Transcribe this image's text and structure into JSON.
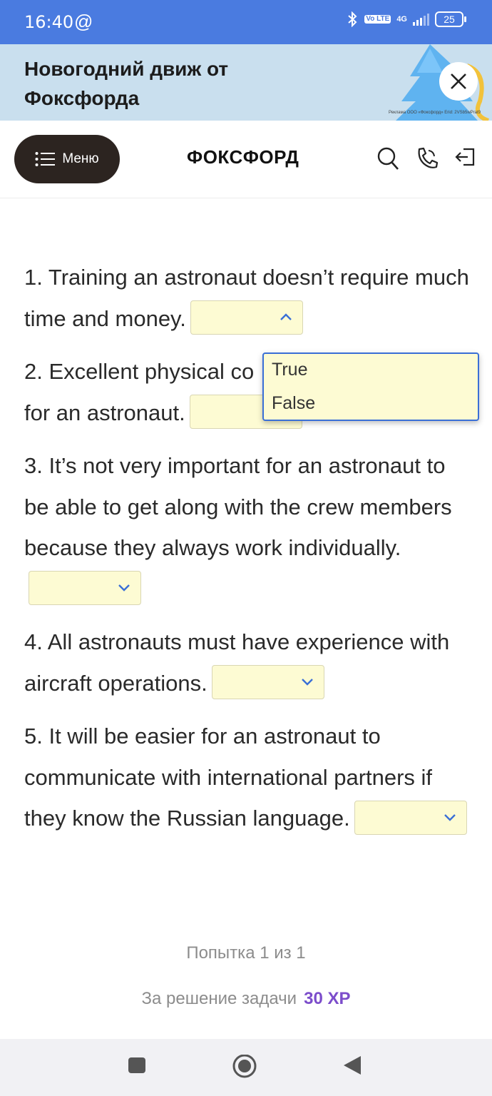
{
  "status_bar": {
    "time": "16:40",
    "at_symbol": "@",
    "network": "4G",
    "volte": "Vo LTE",
    "battery": "25"
  },
  "banner": {
    "title": "Новогодний движ от Фоксфорда",
    "fine_print": "Реклама ООО «Фоксфорд» Erid: 2VSb5wPrat9"
  },
  "header": {
    "menu_label": "Меню",
    "logo": "ФОКСФОРД"
  },
  "questions": [
    {
      "before": "1. Training an astronaut doesn’t require much time and money.",
      "after": "",
      "selected": "",
      "open": true
    },
    {
      "before": "2. Excellent physical co",
      "after": "for an astronaut.",
      "selected": "",
      "open": false
    },
    {
      "before": "3. It’s not very important for an astronaut to be able to get along with the crew members because they always work individually.",
      "after": "",
      "selected": "",
      "open": false
    },
    {
      "before": "4. All astronauts must have experience with aircraft operations.",
      "after": "",
      "selected": "",
      "open": false
    },
    {
      "before": "5. It will be easier for an astronaut to communicate with international partners if they know the Russian language.",
      "after": "",
      "selected": "",
      "open": false
    }
  ],
  "dropdown_options": [
    "True",
    "False"
  ],
  "footer": {
    "attempt": "Попытка 1 из 1",
    "reward_label": "За решение задачи",
    "reward_value": "30 XP"
  },
  "colors": {
    "status_bar": "#4a7be0",
    "banner": "#c9dfee",
    "select_bg": "#fdfbd3",
    "accent": "#3a6fd6",
    "xp": "#7c4dcb"
  }
}
